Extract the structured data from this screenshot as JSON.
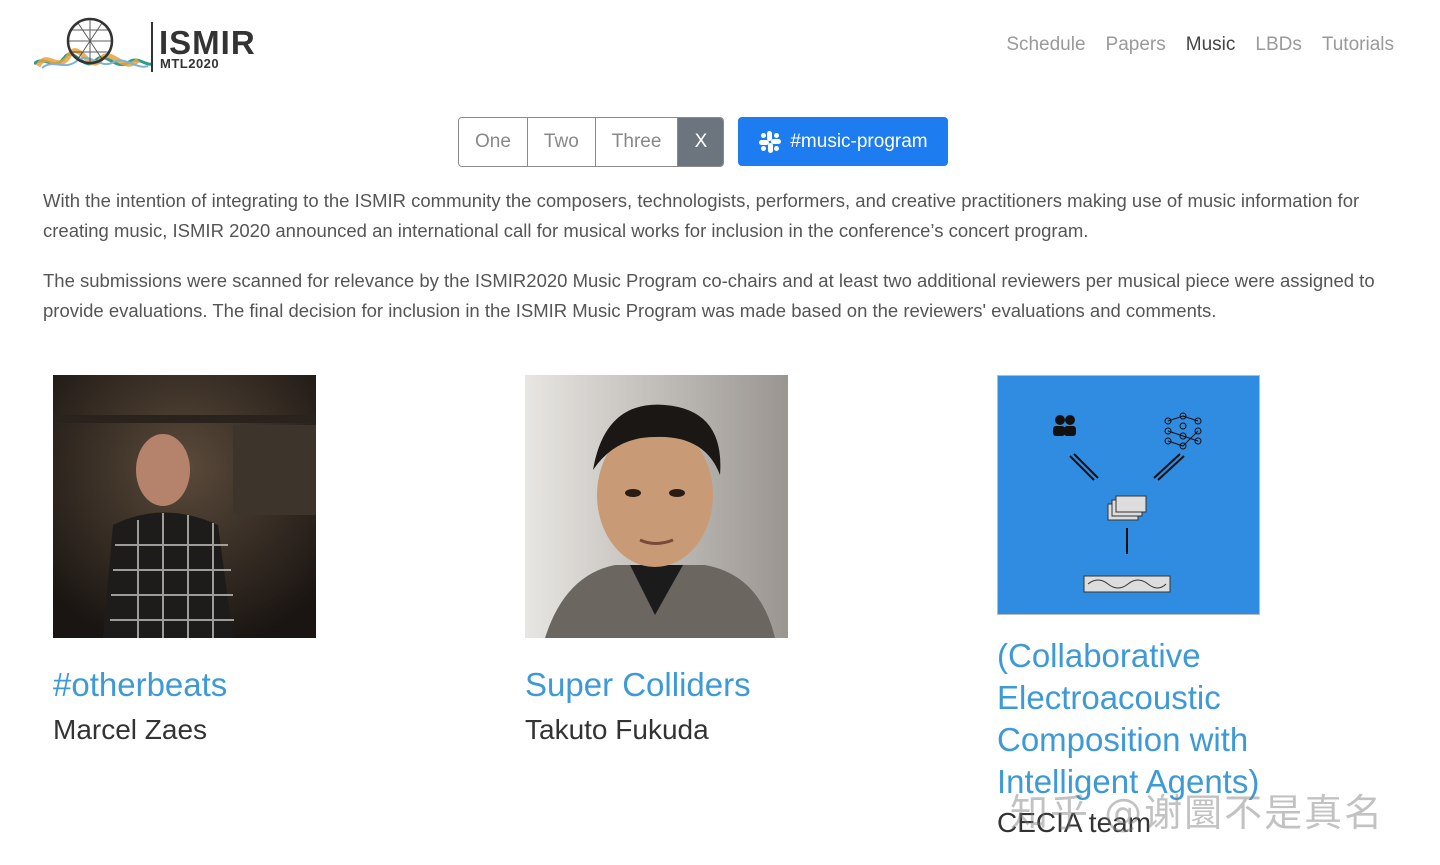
{
  "logo": {
    "title": "ISMIR",
    "subtitle": "MTL2020"
  },
  "nav": {
    "items": [
      {
        "label": "Schedule",
        "active": false
      },
      {
        "label": "Papers",
        "active": false
      },
      {
        "label": "Music",
        "active": true
      },
      {
        "label": "LBDs",
        "active": false
      },
      {
        "label": "Tutorials",
        "active": false
      }
    ]
  },
  "filter": {
    "options": [
      "One",
      "Two",
      "Three"
    ],
    "clear_label": "X"
  },
  "slack": {
    "label": "#music-program",
    "icon": "slack-icon",
    "color": "#1d7cf0"
  },
  "intro": {
    "paragraphs": [
      "With the intention of integrating to the ISMIR community the composers, technologists, performers, and creative practitioners making use of music information for creating music, ISMIR 2020 announced an international call for musical works for inclusion in the conference’s concert program.",
      "The submissions were scanned for relevance by the ISMIR2020 Music Program co-chairs and at least two additional reviewers per musical piece were assigned to provide evaluations. The final decision for inclusion in the ISMIR Music Program was made based on the reviewers' evaluations and comments."
    ]
  },
  "works": [
    {
      "title": "#otherbeats",
      "author": "Marcel Zaes"
    },
    {
      "title": "Super Colliders",
      "author": "Takuto Fukuda"
    },
    {
      "title": "(Collaborative Electroacoustic Composition with Intelligent Agents)",
      "author": "CECIA team"
    }
  ],
  "watermark": "知乎 @谢圜不是真名",
  "colors": {
    "link": "#3d9ad6",
    "accent": "#1d7cf0",
    "diagram_bg": "#2f8ce0"
  }
}
